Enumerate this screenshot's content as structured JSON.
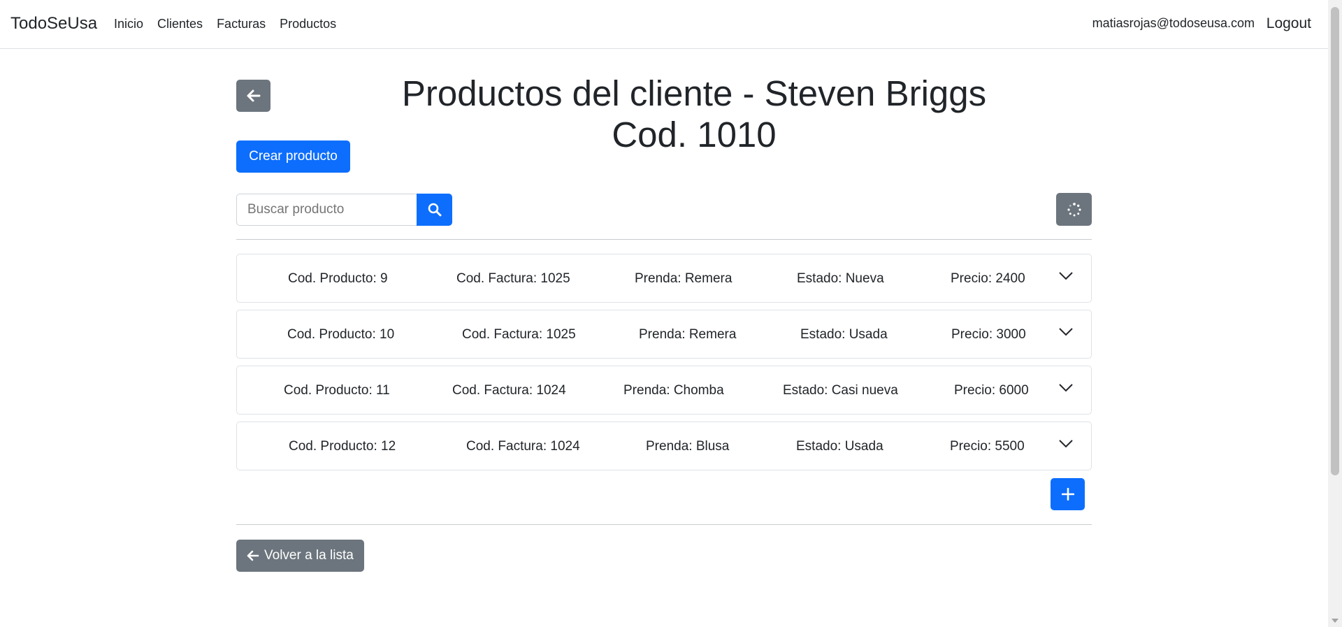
{
  "navbar": {
    "brand": "TodoSeUsa",
    "links": [
      "Inicio",
      "Clientes",
      "Facturas",
      "Productos"
    ],
    "user_email": "matiasrojas@todoseusa.com",
    "logout": "Logout"
  },
  "page": {
    "title": "Productos del cliente - Steven Briggs Cod. 1010",
    "create_button": "Crear producto",
    "search_placeholder": "Buscar producto",
    "back_list_button": "Volver a la lista"
  },
  "products": [
    {
      "cod_producto": "Cod. Producto: 9",
      "cod_factura": "Cod. Factura: 1025",
      "prenda": "Prenda: Remera",
      "estado": "Estado: Nueva",
      "precio": "Precio: 2400"
    },
    {
      "cod_producto": "Cod. Producto: 10",
      "cod_factura": "Cod. Factura: 1025",
      "prenda": "Prenda: Remera",
      "estado": "Estado: Usada",
      "precio": "Precio: 3000"
    },
    {
      "cod_producto": "Cod. Producto: 11",
      "cod_factura": "Cod. Factura: 1024",
      "prenda": "Prenda: Chomba",
      "estado": "Estado: Casi nueva",
      "precio": "Precio: 6000"
    },
    {
      "cod_producto": "Cod. Producto: 12",
      "cod_factura": "Cod. Factura: 1024",
      "prenda": "Prenda: Blusa",
      "estado": "Estado: Usada",
      "precio": "Precio: 5500"
    }
  ],
  "icons": {
    "back": "arrow-left-icon",
    "search": "search-icon",
    "refresh": "spinner-icon",
    "expand": "chevron-down-icon",
    "add": "plus-icon"
  },
  "colors": {
    "primary": "#0d6efd",
    "secondary": "#6c757d"
  }
}
